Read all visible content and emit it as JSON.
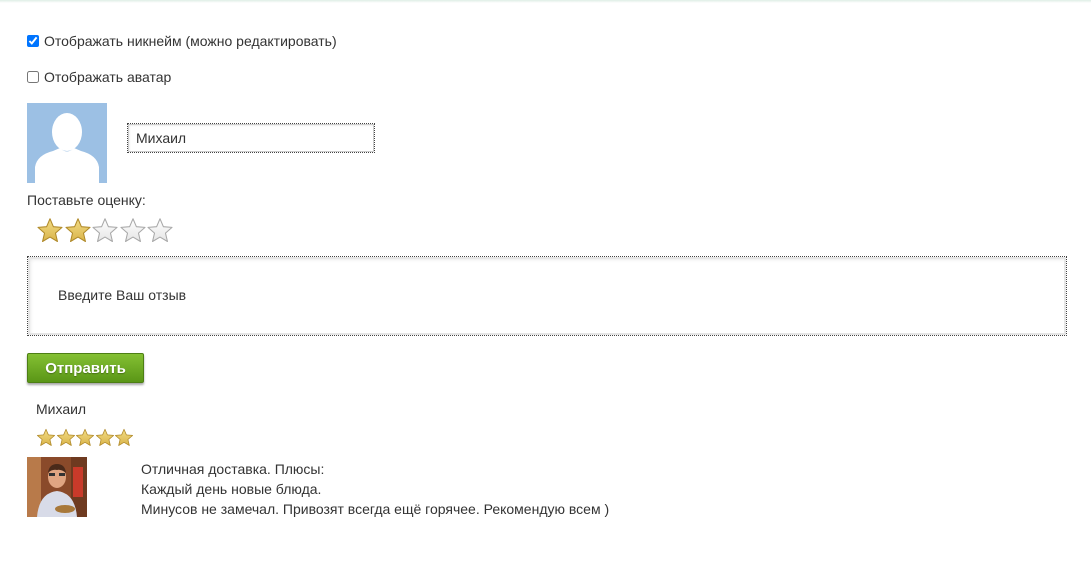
{
  "form": {
    "show_nickname_label": "Отображать никнейм (можно редактировать)",
    "show_nickname_checked": true,
    "show_avatar_label": "Отображать аватар",
    "show_avatar_checked": false,
    "nickname_value": "Михаил",
    "rating_label": "Поставьте оценку:",
    "rating_value": 2,
    "rating_max": 5,
    "review_placeholder": "Введите Ваш отзыв",
    "submit_label": "Отправить"
  },
  "review": {
    "author": "Михаил",
    "rating": 5,
    "rating_max": 5,
    "lines": [
      "Отличная доставка. Плюсы:",
      "Каждый день новые блюда.",
      "Минусов не замечал. Привозят всегда ещё горячее. Рекомендую всем )"
    ]
  },
  "colors": {
    "submit_button": "#6aa823",
    "avatar_placeholder": "#9cc0e4",
    "star_filled": "#d9b44a",
    "star_empty": "#e5e5e5"
  }
}
